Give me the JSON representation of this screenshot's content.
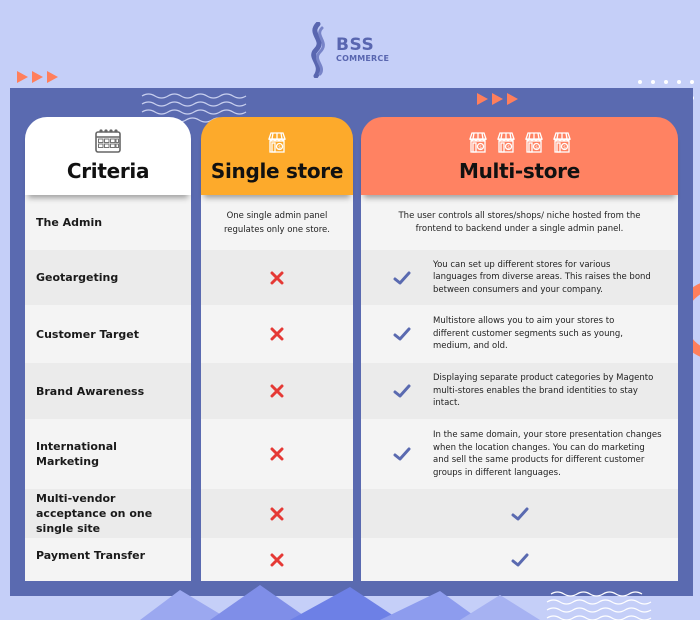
{
  "brand": {
    "name": "BSS",
    "subname": "COMMERCE"
  },
  "columns": [
    {
      "title": "Criteria",
      "icon": "calendar-icon",
      "color": "#ffffff"
    },
    {
      "title": "Single store",
      "icon": "store-icon",
      "color": "#fdaa2b"
    },
    {
      "title": "Multi-store",
      "icon": "store-icon",
      "icon_count": 4,
      "color": "#ff8262"
    }
  ],
  "colors": {
    "background": "#c5cff8",
    "panel": "#5a6ab0",
    "accent_arrow": "#ff7f5c",
    "cross": "#e53935",
    "check": "#5a6ab0"
  },
  "rows": [
    {
      "criteria": "The Admin",
      "single": {
        "type": "text",
        "text": "One single admin panel regulates only one store."
      },
      "multi": {
        "type": "text",
        "text": "The user controls all stores/shops/ niche hosted from the frontend to backend under a single admin panel."
      }
    },
    {
      "criteria": "Geotargeting",
      "single": {
        "type": "cross"
      },
      "multi": {
        "type": "check-text",
        "text": "You can set up different stores for various languages from diverse areas. This raises the bond between consumers and your company."
      }
    },
    {
      "criteria": "Customer Target",
      "single": {
        "type": "cross"
      },
      "multi": {
        "type": "check-text",
        "text": "Multistore allows you to aim your stores to different customer segments such as young, medium, and old."
      }
    },
    {
      "criteria": "Brand Awareness",
      "single": {
        "type": "cross"
      },
      "multi": {
        "type": "check-text",
        "text": "Displaying separate product categories by Magento multi-stores enables the brand identities to stay intact."
      }
    },
    {
      "criteria": "International Marketing",
      "single": {
        "type": "cross"
      },
      "multi": {
        "type": "check-text",
        "text": "In the same domain, your store presentation changes when the location changes. You can do marketing and sell the same products for different customer groups in different languages."
      }
    },
    {
      "criteria": "Multi-vendor acceptance on one single site",
      "single": {
        "type": "cross"
      },
      "multi": {
        "type": "check"
      }
    },
    {
      "criteria": "Payment Transfer",
      "single": {
        "type": "cross"
      },
      "multi": {
        "type": "check"
      }
    }
  ]
}
